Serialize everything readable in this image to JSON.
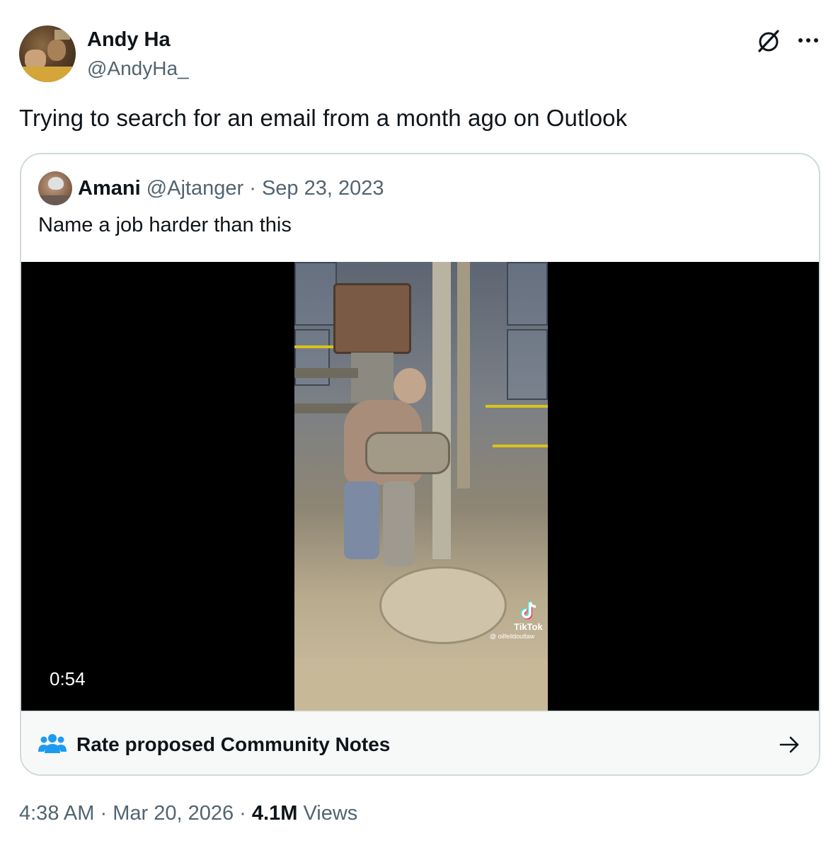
{
  "author": {
    "name": "Andy Ha",
    "handle": "@AndyHa_"
  },
  "tweet": {
    "text": "Trying to search for an email from a month ago on Outlook"
  },
  "quoted": {
    "name": "Amani",
    "handle": "@Ajtanger",
    "separator": "·",
    "date": "Sep 23, 2023",
    "text": "Name a job harder than this",
    "video": {
      "duration": "0:54",
      "watermark_brand": "TikTok",
      "watermark_user": "@ oilfeildoutlaw"
    }
  },
  "community_notes": {
    "label": "Rate proposed Community Notes"
  },
  "footer": {
    "time": "4:38 AM",
    "sep1": "·",
    "date": "Mar 20, 2026",
    "sep2": "·",
    "views_count": "4.1M",
    "views_label": "Views"
  },
  "icons": {
    "grok": "grok-icon",
    "more": "more-icon",
    "community": "people-icon",
    "arrow": "arrow-right-icon"
  },
  "colors": {
    "text_primary": "#0f1419",
    "text_secondary": "#536471",
    "border": "#cfd9de",
    "accent_blue": "#1d9bf0"
  }
}
